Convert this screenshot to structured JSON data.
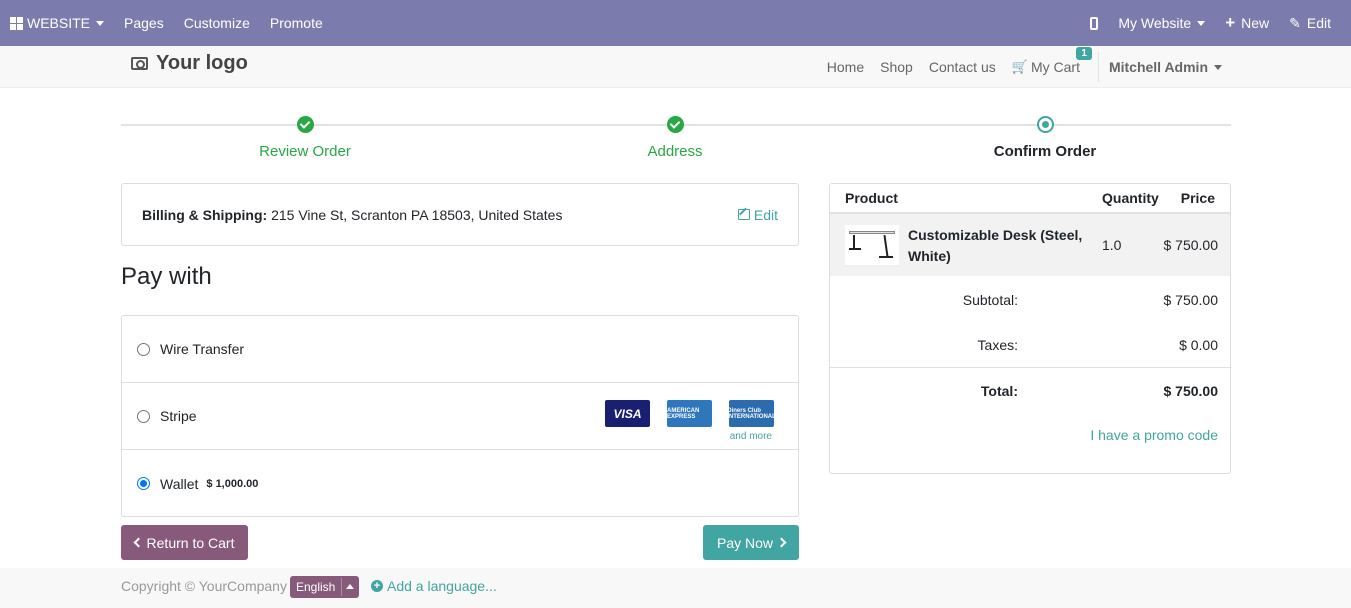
{
  "admin_bar": {
    "website_label": "WEBSITE",
    "menu": [
      "Pages",
      "Customize",
      "Promote"
    ],
    "my_website_label": "My Website",
    "new_label": "New",
    "edit_label": "Edit",
    "plus_glyph": "+",
    "pencil_glyph": "✎"
  },
  "header": {
    "logo_text": "Your logo",
    "nav": [
      "Home",
      "Shop",
      "Contact us"
    ],
    "cart_label": "My Cart",
    "cart_glyph": "🛒",
    "cart_count": "1",
    "user_name": "Mitchell Admin"
  },
  "wizard": {
    "steps": [
      {
        "label": "Review Order",
        "status": "done"
      },
      {
        "label": "Address",
        "status": "done"
      },
      {
        "label": "Confirm Order",
        "status": "current"
      }
    ]
  },
  "billing": {
    "label": "Billing & Shipping:",
    "address": " 215 Vine St, Scranton PA 18503, United States",
    "edit_label": "Edit"
  },
  "payment": {
    "title": "Pay with",
    "methods": [
      {
        "name": "Wire Transfer",
        "selected": false
      },
      {
        "name": "Stripe",
        "selected": false
      },
      {
        "name": "Wallet",
        "selected": true,
        "amount": "$ 1,000.00"
      }
    ],
    "cards": [
      "VISA",
      "AMERICAN EXPRESS",
      "Diners Club INTERNATIONAL"
    ],
    "and_more": "and more"
  },
  "buttons": {
    "return_label": "Return to Cart",
    "pay_label": "Pay Now"
  },
  "summary": {
    "headers": {
      "product": "Product",
      "quantity": "Quantity",
      "price": "Price"
    },
    "line": {
      "name": "Customizable Desk (Steel, White)",
      "quantity": "1.0",
      "price": "$ 750.00"
    },
    "subtotal_label": "Subtotal:",
    "subtotal": "$ 750.00",
    "taxes_label": "Taxes:",
    "taxes": "$ 0.00",
    "total_label": "Total:",
    "total": "$ 750.00",
    "promo_label": "I have a promo code"
  },
  "footer": {
    "copyright": "Copyright © YourCompany",
    "language": "English",
    "add_language": "Add a language..."
  },
  "colors": {
    "admin_bar": "#7c7bad",
    "accent": "#41a5a1",
    "primary": "#875a7b",
    "success": "#28a745"
  }
}
